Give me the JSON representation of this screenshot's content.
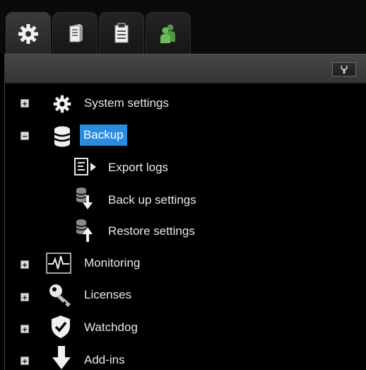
{
  "tabs": [
    {
      "icon": "gear-icon",
      "active": true
    },
    {
      "icon": "server-icon",
      "active": false
    },
    {
      "icon": "clipboard-icon",
      "active": false
    },
    {
      "icon": "users-icon",
      "active": false
    }
  ],
  "toolbar": {
    "tool_icon": "wrench-icon"
  },
  "tree": {
    "system_settings": {
      "label": "System settings",
      "expander": "+",
      "icon": "gear-icon"
    },
    "backup": {
      "label": "Backup",
      "expander": "−",
      "icon": "database-icon",
      "selected": true
    },
    "export_logs": {
      "label": "Export logs",
      "icon": "export-log-icon"
    },
    "back_up_settings": {
      "label": "Back up settings",
      "icon": "database-down-icon"
    },
    "restore_settings": {
      "label": "Restore settings",
      "icon": "database-up-icon"
    },
    "monitoring": {
      "label": "Monitoring",
      "expander": "+",
      "icon": "heartbeat-icon"
    },
    "licenses": {
      "label": "Licenses",
      "expander": "+",
      "icon": "key-icon"
    },
    "watchdog": {
      "label": "Watchdog",
      "expander": "+",
      "icon": "shield-check-icon"
    },
    "add_ins": {
      "label": "Add-ins",
      "expander": "+",
      "icon": "arrow-down-icon"
    }
  },
  "colors": {
    "selection": "#2a8ce0",
    "background": "#000000",
    "toolbar": "#3c3c3c"
  }
}
